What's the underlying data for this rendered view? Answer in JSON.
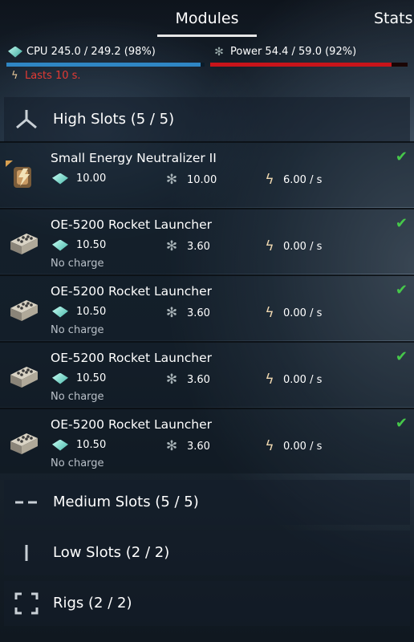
{
  "tabs": {
    "modules": "Modules",
    "stats": "Stats."
  },
  "resources": {
    "cpu_text": "CPU 245.0 / 249.2 (98%)",
    "cpu_fraction": 0.98,
    "power_text": "Power 54.4 / 59.0 (92%)",
    "power_fraction": 0.92,
    "lasts_text": "Lasts 10 s."
  },
  "high_slots": {
    "title": "High Slots (5 / 5)",
    "items": [
      {
        "name": "Small Energy Neutralizer II",
        "cpu": "10.00",
        "power": "10.00",
        "cap": "6.00 / s",
        "charge": ""
      },
      {
        "name": "OE-5200 Rocket Launcher",
        "cpu": "10.50",
        "power": "3.60",
        "cap": "0.00 / s",
        "charge": "No charge"
      },
      {
        "name": "OE-5200 Rocket Launcher",
        "cpu": "10.50",
        "power": "3.60",
        "cap": "0.00 / s",
        "charge": "No charge"
      },
      {
        "name": "OE-5200 Rocket Launcher",
        "cpu": "10.50",
        "power": "3.60",
        "cap": "0.00 / s",
        "charge": "No charge"
      },
      {
        "name": "OE-5200 Rocket Launcher",
        "cpu": "10.50",
        "power": "3.60",
        "cap": "0.00 / s",
        "charge": "No charge"
      }
    ]
  },
  "medium_slots": {
    "title": "Medium Slots (5 / 5)"
  },
  "low_slots": {
    "title": "Low Slots (2 / 2)"
  },
  "rigs": {
    "title": "Rigs (2 / 2)"
  },
  "colors": {
    "cpu_bar": "#2f86c4",
    "power_bar": "#c8141a",
    "warning": "#e43a34",
    "check": "#46c84a"
  }
}
